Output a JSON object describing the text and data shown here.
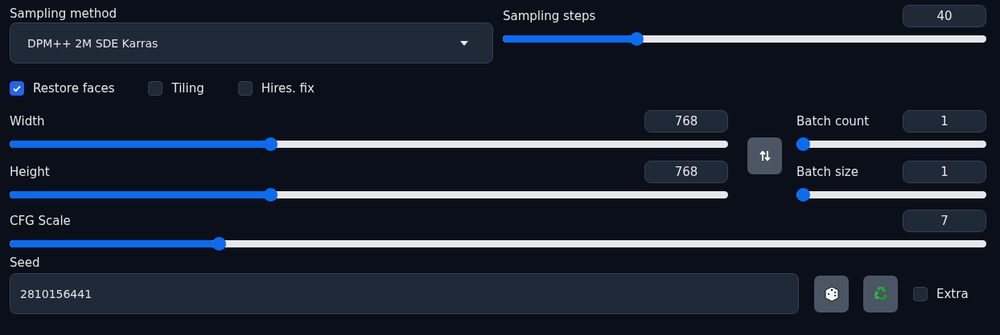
{
  "sampling_method": {
    "label": "Sampling method",
    "value": "DPM++ 2M SDE Karras"
  },
  "sampling_steps": {
    "label": "Sampling steps",
    "value": "40",
    "level": 0.27
  },
  "options": [
    {
      "label": "Restore faces",
      "checked": true
    },
    {
      "label": "Tiling",
      "checked": false
    },
    {
      "label": "Hires. fix",
      "checked": false
    }
  ],
  "width": {
    "label": "Width",
    "value": "768",
    "level": 0.36
  },
  "height": {
    "label": "Height",
    "value": "768",
    "level": 0.36
  },
  "batch_count": {
    "label": "Batch count",
    "value": "1",
    "level": 0
  },
  "batch_size": {
    "label": "Batch size",
    "value": "1",
    "level": 0
  },
  "cfg_scale": {
    "label": "CFG Scale",
    "value": "7",
    "level": 0.21
  },
  "seed": {
    "label": "Seed",
    "value": "2810156441"
  },
  "extra": {
    "label": "Extra",
    "checked": false
  }
}
